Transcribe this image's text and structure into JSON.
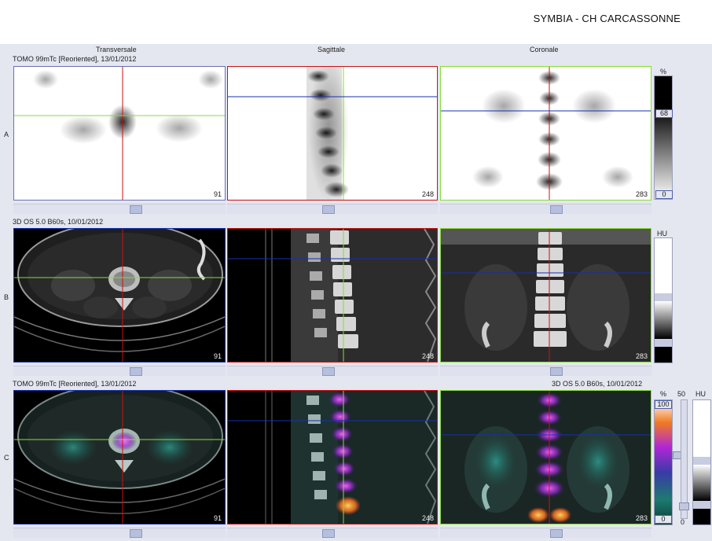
{
  "header": {
    "title": "SYMBIA - CH CARCASSONNE"
  },
  "columns": [
    "Transversale",
    "Sagittale",
    "Coronale"
  ],
  "rows": [
    {
      "label": "A",
      "series": "TOMO 99mTc [Reoriented], 13/01/2012"
    },
    {
      "label": "B",
      "series": "3D  OS  5.0  B60s, 10/01/2012"
    },
    {
      "label": "C",
      "series": "TOMO 99mTc [Reoriented], 13/01/2012",
      "series_right": "3D  OS  5.0  B60s, 10/01/2012"
    }
  ],
  "slices": {
    "transverse": "91",
    "sagittal": "248",
    "coronal": "283"
  },
  "colorbars": {
    "a": {
      "unit": "%",
      "top": "68",
      "bottom": "0"
    },
    "b": {
      "unit": "HU"
    },
    "c": {
      "unit": "%",
      "top": "100",
      "bottom": "0",
      "mix_label": "50",
      "mix_low": "0",
      "ct_unit": "HU"
    }
  },
  "colors": {
    "red": "#cc1111",
    "green": "#88dd33",
    "blue": "#1530b0",
    "panel_bg": "#e4e6f0"
  }
}
